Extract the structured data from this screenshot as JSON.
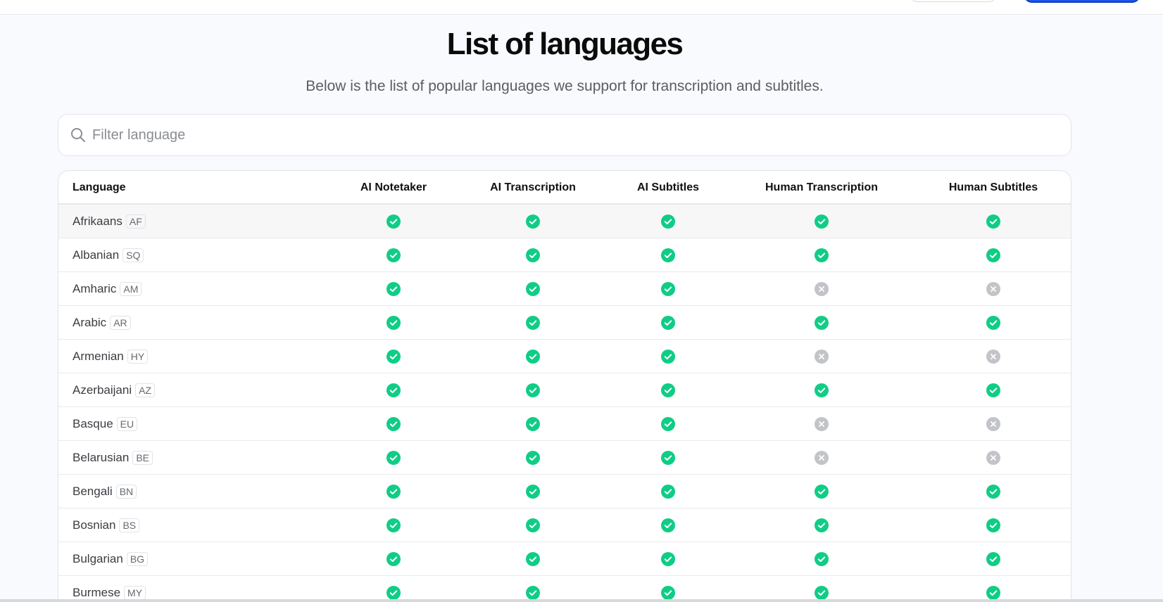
{
  "page": {
    "title": "List of languages",
    "subtitle": "Below is the list of popular languages we support for transcription and subtitles."
  },
  "search": {
    "placeholder": "Filter language",
    "value": ""
  },
  "colors": {
    "supported": "#10cd86",
    "unsupported": "#c2c4c8",
    "primary": "#1f56e8"
  },
  "icons": {
    "search": "search-icon",
    "supported": "check-circle-icon",
    "unsupported": "x-circle-icon"
  },
  "table": {
    "headers": [
      "Language",
      "AI Notetaker",
      "AI Transcription",
      "AI Subtitles",
      "Human Transcription",
      "Human Subtitles"
    ],
    "rows": [
      {
        "name": "Afrikaans",
        "code": "AF",
        "support": [
          true,
          true,
          true,
          true,
          true
        ]
      },
      {
        "name": "Albanian",
        "code": "SQ",
        "support": [
          true,
          true,
          true,
          true,
          true
        ]
      },
      {
        "name": "Amharic",
        "code": "AM",
        "support": [
          true,
          true,
          true,
          false,
          false
        ]
      },
      {
        "name": "Arabic",
        "code": "AR",
        "support": [
          true,
          true,
          true,
          true,
          true
        ]
      },
      {
        "name": "Armenian",
        "code": "HY",
        "support": [
          true,
          true,
          true,
          false,
          false
        ]
      },
      {
        "name": "Azerbaijani",
        "code": "AZ",
        "support": [
          true,
          true,
          true,
          true,
          true
        ]
      },
      {
        "name": "Basque",
        "code": "EU",
        "support": [
          true,
          true,
          true,
          false,
          false
        ]
      },
      {
        "name": "Belarusian",
        "code": "BE",
        "support": [
          true,
          true,
          true,
          false,
          false
        ]
      },
      {
        "name": "Bengali",
        "code": "BN",
        "support": [
          true,
          true,
          true,
          true,
          true
        ]
      },
      {
        "name": "Bosnian",
        "code": "BS",
        "support": [
          true,
          true,
          true,
          true,
          true
        ]
      },
      {
        "name": "Bulgarian",
        "code": "BG",
        "support": [
          true,
          true,
          true,
          true,
          true
        ]
      },
      {
        "name": "Burmese",
        "code": "MY",
        "support": [
          true,
          true,
          true,
          true,
          true
        ]
      }
    ]
  }
}
